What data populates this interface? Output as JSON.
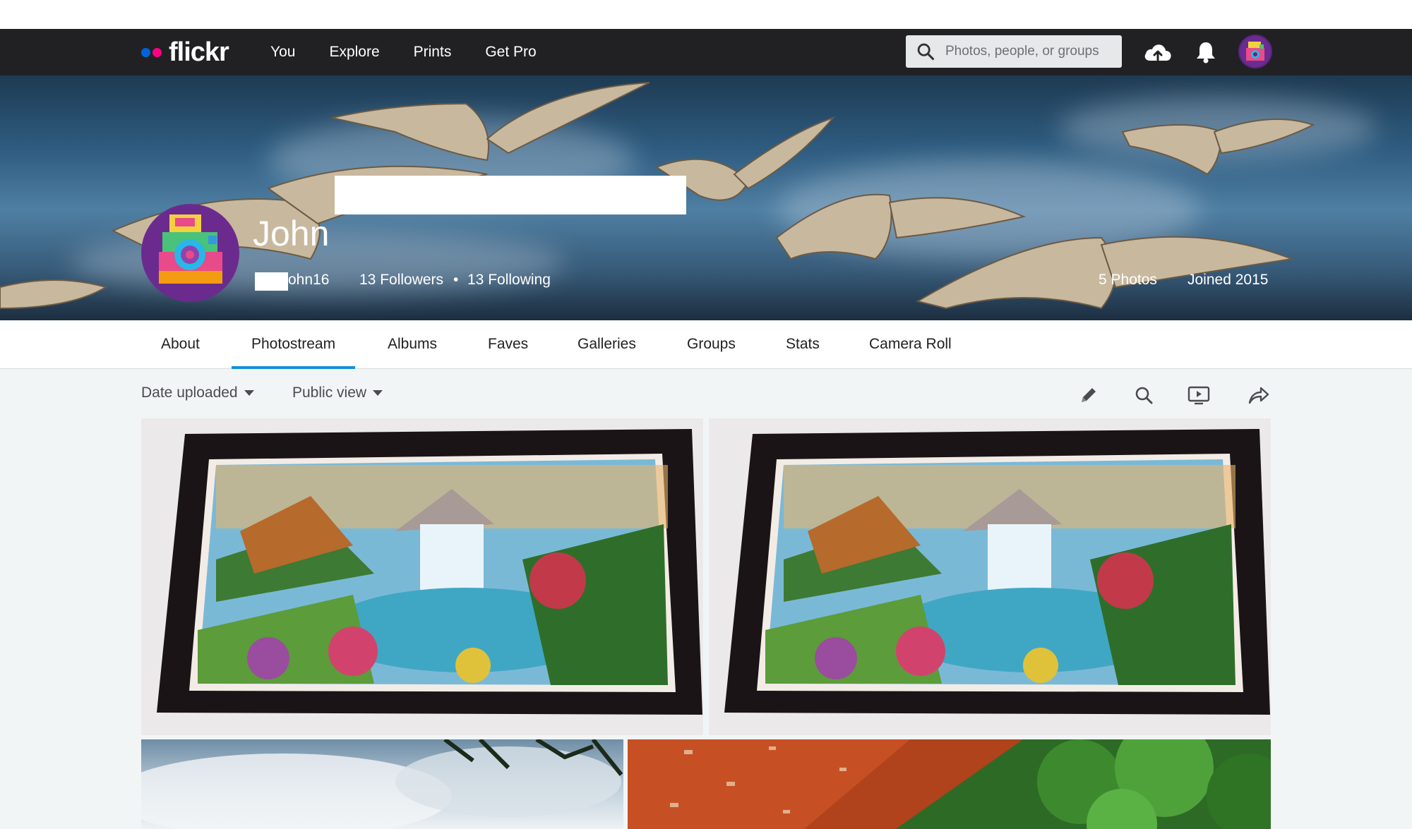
{
  "app": {
    "logo_text": "flickr"
  },
  "nav": {
    "links": [
      "You",
      "Explore",
      "Prints",
      "Get Pro"
    ],
    "search_placeholder": "Photos, people, or groups",
    "icons": [
      "upload-cloud-icon",
      "bell-icon",
      "avatar"
    ]
  },
  "profile": {
    "first_name": "John",
    "username_suffix": "ohn16",
    "followers": "13 Followers",
    "separator": "•",
    "following": "13 Following",
    "photos": "5 Photos",
    "joined": "Joined 2015"
  },
  "tabs": [
    {
      "label": "About",
      "active": false
    },
    {
      "label": "Photostream",
      "active": true
    },
    {
      "label": "Albums",
      "active": false
    },
    {
      "label": "Faves",
      "active": false
    },
    {
      "label": "Galleries",
      "active": false
    },
    {
      "label": "Groups",
      "active": false
    },
    {
      "label": "Stats",
      "active": false
    },
    {
      "label": "Camera Roll",
      "active": false
    }
  ],
  "toolbar": {
    "sort_label": "Date uploaded",
    "view_label": "Public view",
    "icons": [
      "pencil-icon",
      "search-icon",
      "slideshow-icon",
      "share-icon"
    ]
  },
  "colors": {
    "accent": "#128fdc",
    "navbar": "#212124",
    "logo_blue": "#0063dc",
    "logo_pink": "#ff0084"
  }
}
